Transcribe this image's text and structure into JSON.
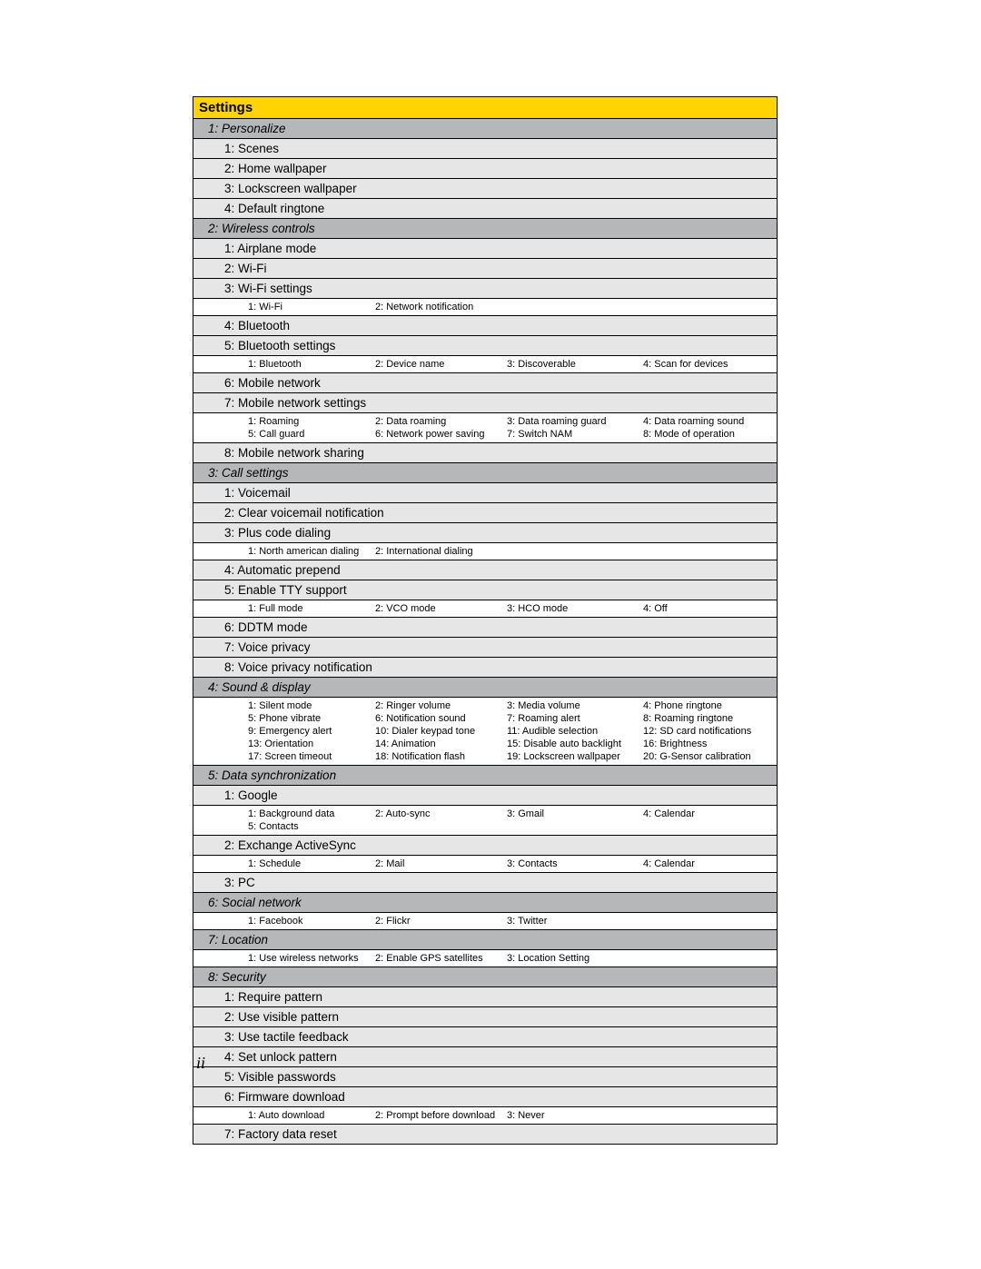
{
  "title": "Settings",
  "page_number": "ii",
  "sections": [
    {
      "head": "1: Personalize",
      "rows": [
        {
          "label": "1: Scenes"
        },
        {
          "label": "2: Home wallpaper"
        },
        {
          "label": "3: Lockscreen wallpaper"
        },
        {
          "label": "4: Default ringtone"
        }
      ]
    },
    {
      "head": "2: Wireless controls",
      "rows": [
        {
          "label": "1: Airplane mode"
        },
        {
          "label": "2: Wi-Fi"
        },
        {
          "label": "3: Wi-Fi settings",
          "subs": [
            "1: Wi-Fi",
            "2: Network notification"
          ]
        },
        {
          "label": "4: Bluetooth"
        },
        {
          "label": "5: Bluetooth settings",
          "subs": [
            "1: Bluetooth",
            "2: Device name",
            "3: Discoverable",
            "4: Scan for devices"
          ]
        },
        {
          "label": "6: Mobile network"
        },
        {
          "label": "7: Mobile network settings",
          "subs": [
            "1: Roaming",
            "2: Data roaming",
            "3: Data roaming guard",
            "4: Data roaming sound",
            "5: Call guard",
            "6: Network power saving",
            "7: Switch NAM",
            "8: Mode of operation"
          ]
        },
        {
          "label": "8: Mobile network sharing"
        }
      ]
    },
    {
      "head": "3: Call settings",
      "rows": [
        {
          "label": "1: Voicemail"
        },
        {
          "label": "2: Clear voicemail notification"
        },
        {
          "label": "3: Plus code dialing",
          "subs": [
            "1: North american dialing",
            "2: International dialing"
          ]
        },
        {
          "label": "4: Automatic prepend"
        },
        {
          "label": "5: Enable TTY support",
          "subs": [
            "1: Full mode",
            "2: VCO mode",
            "3: HCO mode",
            "4: Off"
          ]
        },
        {
          "label": "6: DDTM mode"
        },
        {
          "label": "7: Voice privacy"
        },
        {
          "label": "8: Voice privacy notification"
        }
      ]
    },
    {
      "head": "4: Sound & display",
      "rows": [
        {
          "label": null,
          "subs": [
            "1: Silent mode",
            "2: Ringer volume",
            "3: Media volume",
            "4: Phone ringtone",
            "5: Phone vibrate",
            "6: Notification sound",
            "7: Roaming alert",
            "8: Roaming ringtone",
            "9: Emergency alert",
            "10: Dialer keypad tone",
            "11: Audible selection",
            "12: SD card notifications",
            "13: Orientation",
            "14: Animation",
            "15: Disable auto backlight",
            "16: Brightness",
            "17: Screen timeout",
            "18: Notification flash",
            "19: Lockscreen wallpaper",
            "20: G-Sensor calibration"
          ]
        }
      ]
    },
    {
      "head": "5: Data synchronization",
      "rows": [
        {
          "label": "1: Google",
          "subs": [
            "1: Background data",
            "2: Auto-sync",
            "3: Gmail",
            "4: Calendar",
            "5: Contacts"
          ]
        },
        {
          "label": "2: Exchange ActiveSync",
          "subs": [
            "1: Schedule",
            "2: Mail",
            "3: Contacts",
            "4: Calendar"
          ]
        },
        {
          "label": "3: PC"
        }
      ]
    },
    {
      "head": "6: Social network",
      "rows": [
        {
          "label": null,
          "subs": [
            "1: Facebook",
            "2: Flickr",
            "3: Twitter"
          ]
        }
      ]
    },
    {
      "head": "7: Location",
      "rows": [
        {
          "label": null,
          "subs": [
            "1: Use wireless networks",
            "2: Enable GPS satellites",
            "3: Location Setting"
          ]
        }
      ]
    },
    {
      "head": "8: Security",
      "rows": [
        {
          "label": "1: Require pattern"
        },
        {
          "label": "2: Use visible pattern"
        },
        {
          "label": "3: Use tactile feedback"
        },
        {
          "label": "4: Set unlock pattern"
        },
        {
          "label": "5: Visible passwords"
        },
        {
          "label": "6: Firmware download",
          "subs": [
            "1: Auto download",
            "2: Prompt before download",
            "3: Never"
          ]
        },
        {
          "label": "7: Factory data reset"
        }
      ]
    }
  ]
}
